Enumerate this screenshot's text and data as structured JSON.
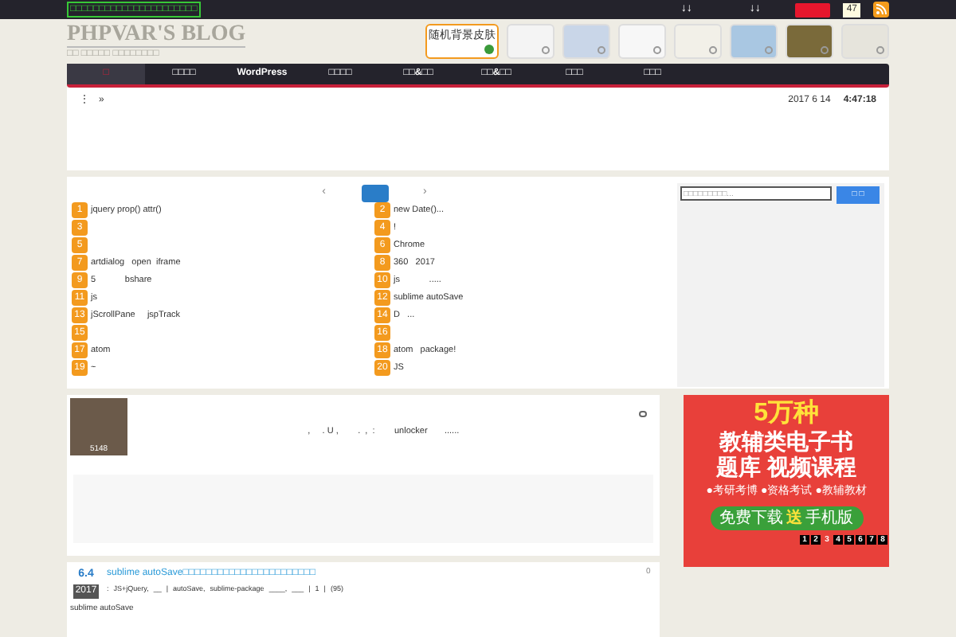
{
  "top_bar": {
    "notice": "□□□□□□□□□□□□□□□□□□□□□□",
    "links": [
      "↓↓",
      "↓↓"
    ],
    "follow_count": "47"
  },
  "header": {
    "title": "PHPVAR'S BLOG",
    "subtitle": "□□ □□□□□ □□□□□□□□",
    "skins": [
      {
        "label": "随机背景皮肤",
        "kind": "random",
        "selected": true
      },
      {
        "kind": "grid",
        "selected": false
      },
      {
        "kind": "blue",
        "selected": false
      },
      {
        "kind": "lines",
        "selected": false
      },
      {
        "kind": "plain",
        "selected": false
      },
      {
        "kind": "sky",
        "selected": false
      },
      {
        "kind": "field",
        "selected": false
      },
      {
        "kind": "bird",
        "selected": false
      }
    ]
  },
  "nav": [
    {
      "label": "□",
      "selected": true
    },
    {
      "label": "□□□□",
      "selected": false
    },
    {
      "label": "WordPress",
      "selected": false
    },
    {
      "label": "□□□□",
      "selected": false
    },
    {
      "label": "□□&□□",
      "selected": false
    },
    {
      "label": "□□&□□",
      "selected": false
    },
    {
      "label": "□□□",
      "selected": false
    },
    {
      "label": "□□□",
      "selected": false
    }
  ],
  "info_bar": {
    "left": [
      "⋮",
      "»"
    ],
    "date": "2017 6 14",
    "time": "4:47:18"
  },
  "hot_list": {
    "prev": "‹",
    "next": "›",
    "left": [
      {
        "n": "1",
        "t": "jquery prop() attr()"
      },
      {
        "n": "3"
      },
      {
        "n": "5"
      },
      {
        "n": "7",
        "t": "artdialog   open  iframe"
      },
      {
        "n": "9",
        "t": "5            bshare"
      },
      {
        "n": "11",
        "t": "js"
      },
      {
        "n": "13",
        "t": "jScrollPane     jspTrack"
      },
      {
        "n": "15"
      },
      {
        "n": "17",
        "t": "atom"
      },
      {
        "n": "19",
        "t": "~"
      }
    ],
    "right": [
      {
        "n": "2",
        "t": "new Date()..."
      },
      {
        "n": "4",
        "t": "!"
      },
      {
        "n": "6",
        "t": "Chrome"
      },
      {
        "n": "8",
        "t": "360   2017"
      },
      {
        "n": "10",
        "t": "js            ....."
      },
      {
        "n": "12",
        "t": "sublime autoSave"
      },
      {
        "n": "14",
        "t": "D   ..."
      },
      {
        "n": "16"
      },
      {
        "n": "18",
        "t": "atom   package!"
      },
      {
        "n": "20",
        "t": "JS"
      }
    ],
    "search": {
      "placeholder": "□□□□□□□□□...",
      "button": "□ □"
    }
  },
  "featured": {
    "views": "5148",
    "text": ",     . U ,        .  ,  :        unlocker       ......"
  },
  "ad": {
    "headline": "5万种",
    "line1": "教辅类电子书",
    "line2": "题库 视频课程",
    "bullets": [
      "●考研考博",
      "●资格考试",
      "●教辅教材"
    ],
    "cta": "免费下载",
    "cta_mark": "送",
    "cta_tail": "手机版",
    "pages": [
      {
        "label": "1",
        "selected": false
      },
      {
        "label": "2",
        "selected": false
      },
      {
        "label": "3",
        "selected": true
      },
      {
        "label": "4",
        "selected": false
      },
      {
        "label": "5",
        "selected": false
      },
      {
        "label": "6",
        "selected": false
      },
      {
        "label": "7",
        "selected": false
      },
      {
        "label": "8",
        "selected": false
      }
    ]
  },
  "post": {
    "day": "6.4",
    "year": "2017",
    "title": "sublime autoSave□□□□□□□□□□□□□□□□□□□□□□□",
    "comments": "0",
    "meta": [
      ":",
      "JS+jQuery,",
      "__",
      "|",
      "autoSave,",
      "sublime-package",
      "____,",
      "___",
      "|",
      "1",
      "|",
      "(95)"
    ],
    "excerpt": "sublime autoSave"
  }
}
